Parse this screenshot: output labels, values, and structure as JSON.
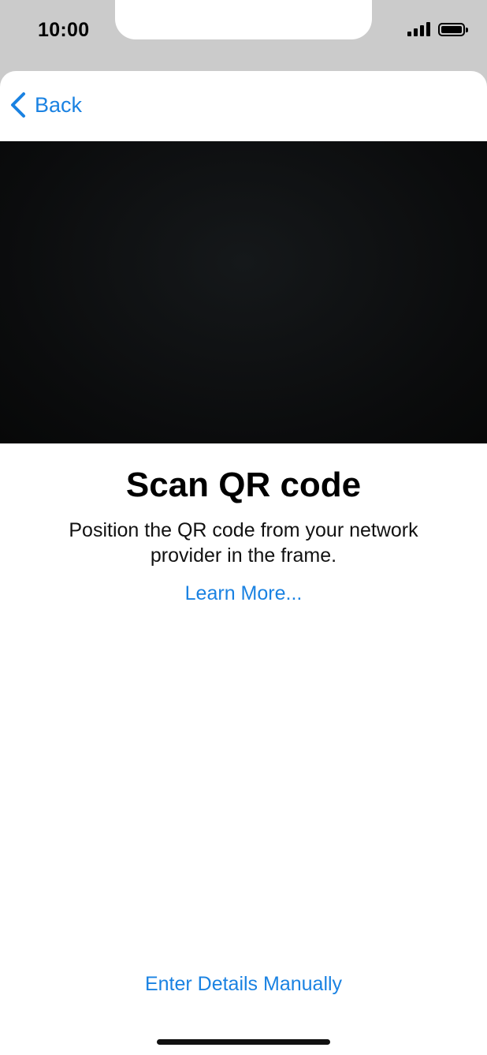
{
  "status_bar": {
    "time": "10:00",
    "icons": [
      "signal-icon",
      "battery-icon"
    ]
  },
  "nav": {
    "back_label": "Back",
    "back_icon": "chevron-left-icon"
  },
  "main": {
    "title": "Scan QR code",
    "subtitle": "Position the QR code from your network provider in the frame.",
    "learn_more": "Learn More...",
    "enter_manually": "Enter Details Manually"
  },
  "colors": {
    "accent": "#1a82e2",
    "camera_bg": "#0b0c0d",
    "status_bg": "#cbcbcb"
  }
}
